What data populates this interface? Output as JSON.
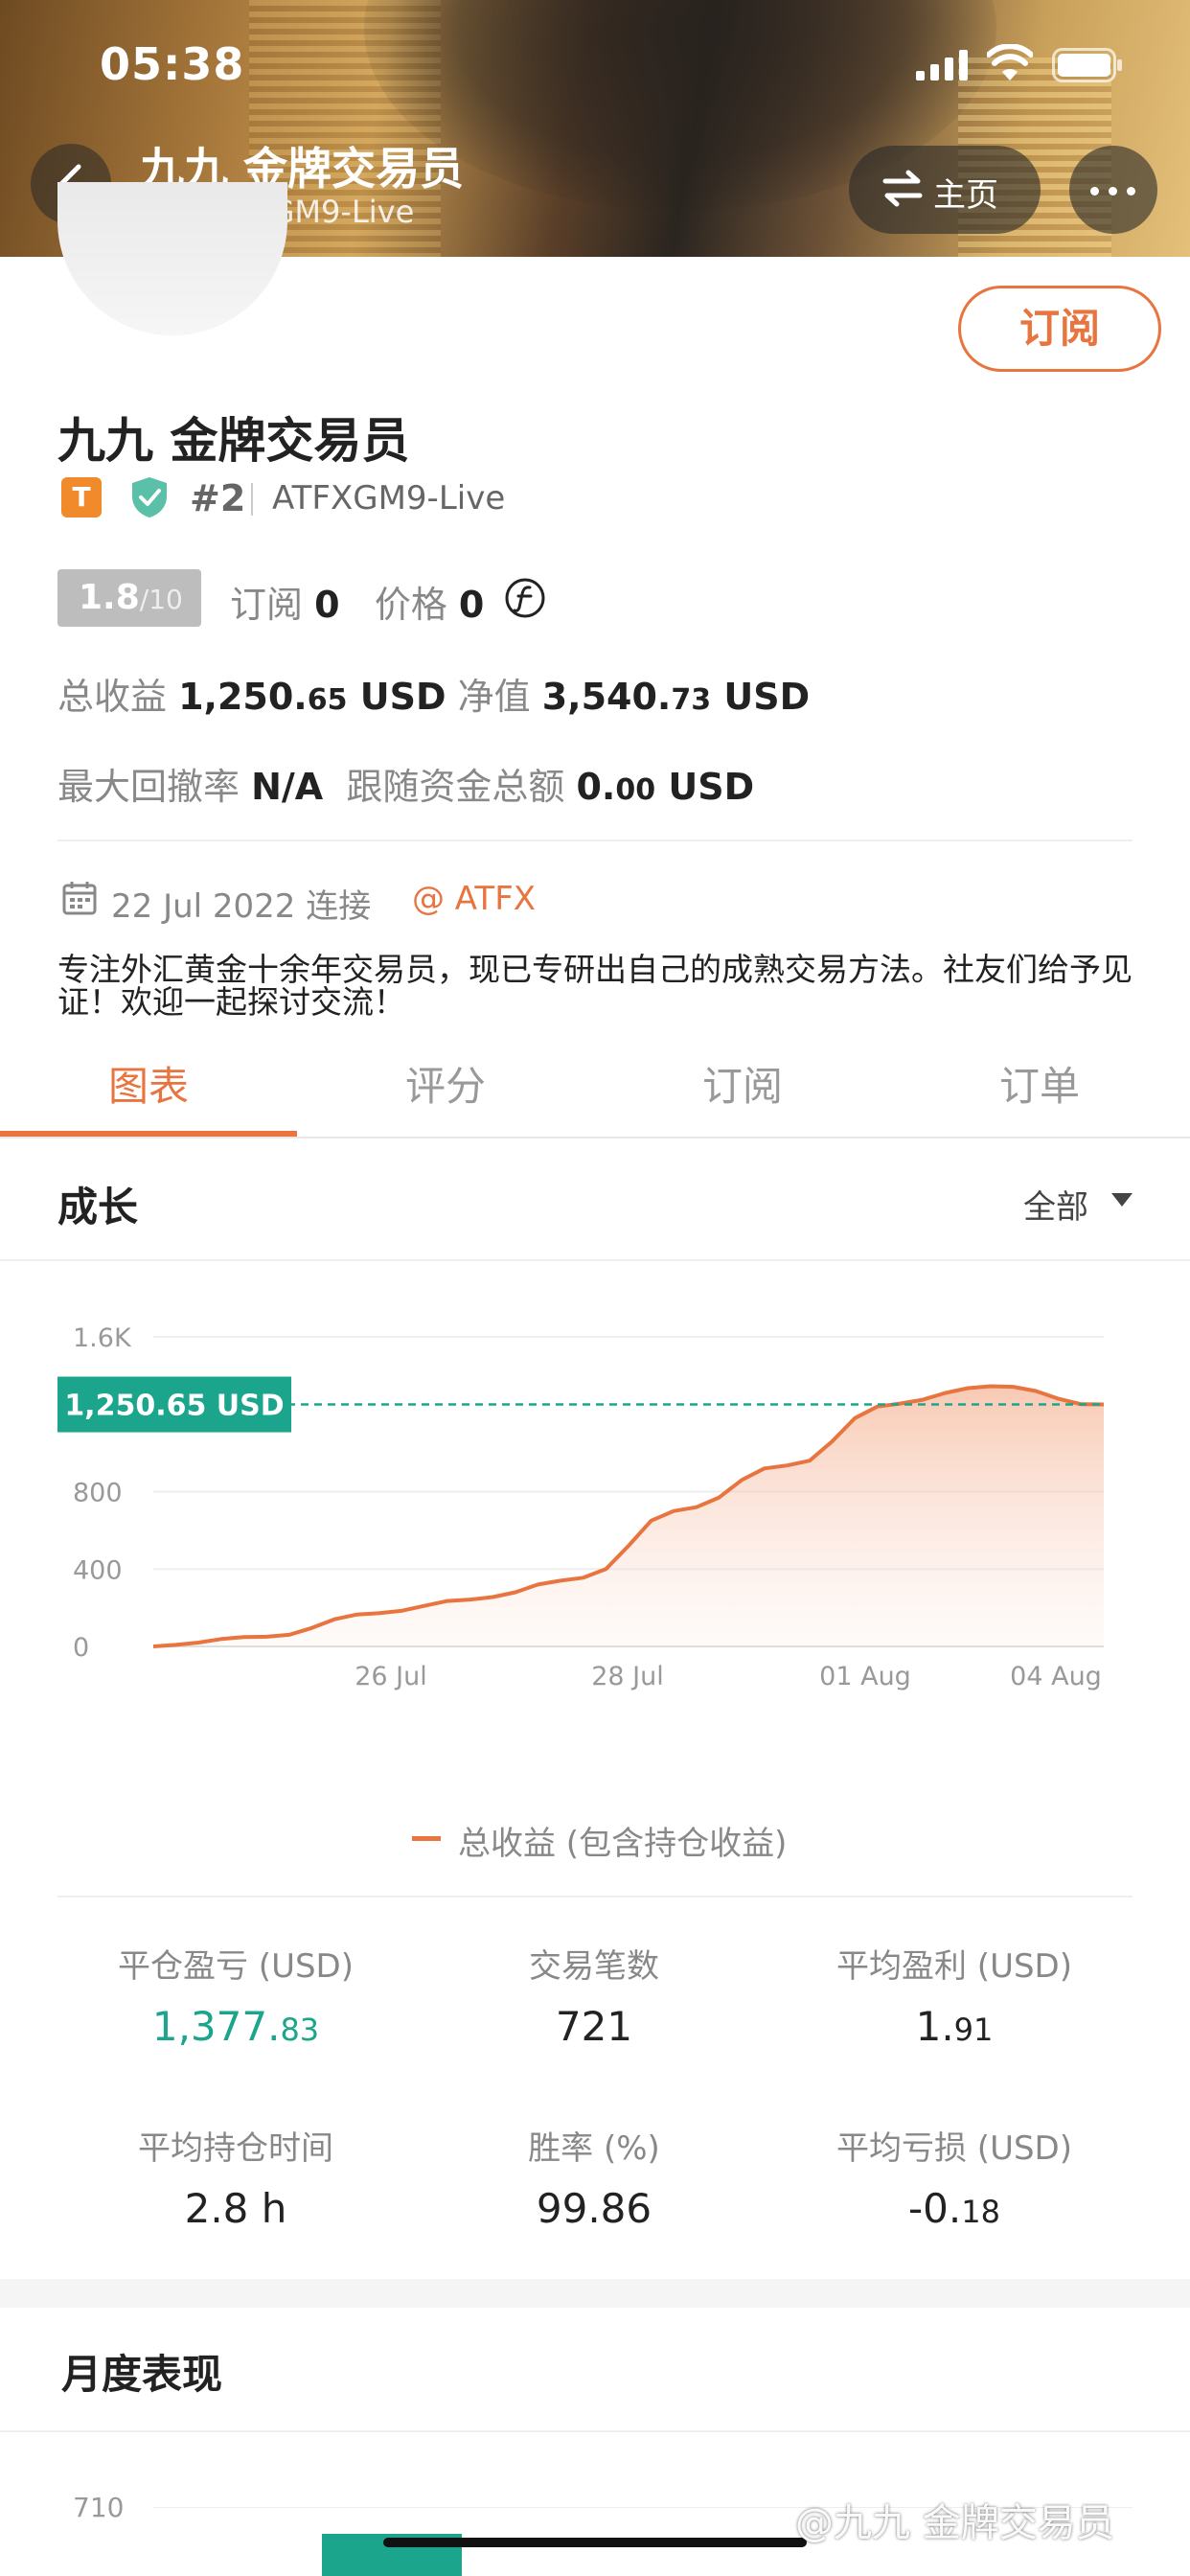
{
  "status_bar": {
    "time": "05:38"
  },
  "header": {
    "title": "九九 金牌交易员",
    "subtitle": "#2 ATFXGM9-Live",
    "home_label": "主页"
  },
  "profile": {
    "subscribe_button": "订阅",
    "name": "九九 金牌交易员",
    "badge_letter": "T",
    "rank": "#2",
    "account": "ATFXGM9-Live",
    "score": "1.8",
    "score_max": "/10",
    "subscriptions_label": "订阅",
    "subscriptions_value": "0",
    "price_label": "价格",
    "price_value": "0",
    "total_profit_label": "总收益",
    "total_profit_int": "1,250.",
    "total_profit_dec": "65",
    "total_profit_unit": "USD",
    "equity_label": "净值",
    "equity_int": "3,540.",
    "equity_dec": "73",
    "equity_unit": "USD",
    "max_drawdown_label": "最大回撤率",
    "max_drawdown_value": "N/A",
    "follower_funds_label": "跟随资金总额",
    "follower_funds_int": "0.",
    "follower_funds_dec": "00",
    "follower_funds_unit": "USD",
    "connected_date": "22 Jul 2022 连接",
    "broker": "@ ATFX",
    "bio": "专注外汇黄金十余年交易员，现已专研出自己的成熟交易方法。社友们给予见证！欢迎一起探讨交流！"
  },
  "tabs": [
    "图表",
    "评分",
    "订阅",
    "订单"
  ],
  "active_tab": "图表",
  "growth": {
    "title": "成长",
    "filter": "全部"
  },
  "chart_data": {
    "type": "area",
    "x_ticks": [
      "26 Jul",
      "28 Jul",
      "01 Aug",
      "04 Aug"
    ],
    "y_ticks": [
      "1.6K",
      "800",
      "400",
      "0"
    ],
    "ylim": [
      0,
      1600
    ],
    "current_value_label": "1,250.65 USD",
    "current_value": 1250.65,
    "series": [
      {
        "name": "总收益 (包含持仓收益)",
        "color": "#e8743f",
        "values": [
          0,
          8,
          20,
          38,
          48,
          50,
          60,
          95,
          140,
          165,
          172,
          185,
          210,
          235,
          242,
          255,
          280,
          320,
          340,
          355,
          400,
          520,
          650,
          700,
          720,
          770,
          860,
          920,
          935,
          960,
          1060,
          1180,
          1240,
          1255,
          1275,
          1310,
          1335,
          1345,
          1342,
          1320,
          1280,
          1252,
          1250.65
        ]
      }
    ]
  },
  "stats": [
    {
      "label": "平仓盈亏 (USD)",
      "int": "1,377.",
      "dec": "83",
      "color": "green"
    },
    {
      "label": "交易笔数",
      "int": "721",
      "dec": ""
    },
    {
      "label": "平均盈利 (USD)",
      "int": "1.",
      "dec": "91"
    },
    {
      "label": "平均持仓时间",
      "int": "2.8 h",
      "dec": ""
    },
    {
      "label": "胜率 (%)",
      "int": "99.86",
      "dec": ""
    },
    {
      "label": "平均亏损 (USD)",
      "int": "-0.",
      "dec": "18"
    }
  ],
  "monthly": {
    "title": "月度表现",
    "y_tick": "710"
  },
  "watermark": "@九九 金牌交易员",
  "colors": {
    "accent": "#e8743f",
    "green": "#1aa58c"
  }
}
